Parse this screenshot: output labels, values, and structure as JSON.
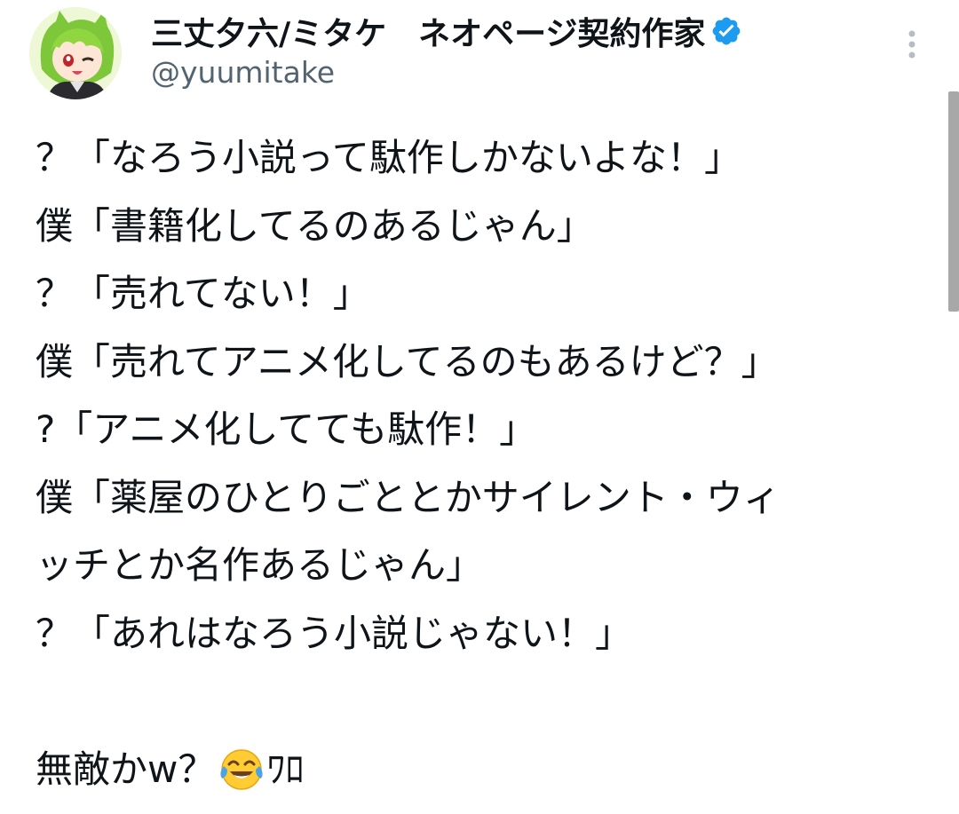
{
  "author": {
    "display_name": "三丈夕六/ミタケ　ネオページ契約作家",
    "handle": "@yuumitake",
    "verified": true,
    "verified_color": "#1d9bf0"
  },
  "tweet": {
    "lines": [
      "？「なろう小説って駄作しかないよな！」",
      "僕「書籍化してるのあるじゃん」",
      "？「売れてない！」",
      "僕「売れてアニメ化してるのもあるけど？」",
      "?「アニメ化してても駄作！」",
      "僕「薬屋のひとりごととかサイレント・ウィ",
      "ッチとか名作あるじゃん」",
      "？「あれはなろう小説じゃない！」",
      ""
    ],
    "final_before": "無敵かw？",
    "final_emoji": "face-with-tears-of-joy",
    "final_after": "ﾜﾛ"
  },
  "colors": {
    "text": "#0f1419",
    "secondary": "#536471",
    "accent": "#1d9bf0",
    "scrollbar": "#a8a8a8"
  }
}
